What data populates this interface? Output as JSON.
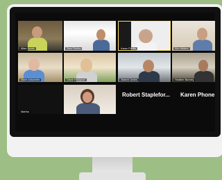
{
  "participants": {
    "p1": "Allan Jones",
    "p2": "Sam Fontes",
    "p3": "Karen Pfeifer",
    "p4": "Kim Heliere",
    "p5": "Marie Antoinette",
    "p6": "Diane Hampson",
    "p7": "Jeanne Jones",
    "p8": "Heather Bonney",
    "p9": "Martha",
    "phone1": "Robert Staplefor...",
    "phone2": "Karen Phone"
  }
}
